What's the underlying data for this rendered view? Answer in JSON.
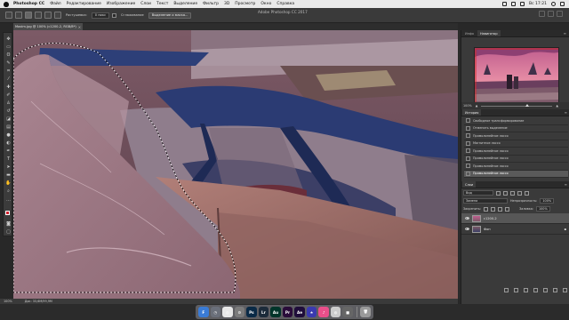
{
  "menubar": {
    "app": "Photoshop CC",
    "items": [
      "Файл",
      "Редактирование",
      "Изображение",
      "Слои",
      "Текст",
      "Выделение",
      "Фильтр",
      "3D",
      "Просмотр",
      "Окно",
      "Справка"
    ],
    "clock": "Вс 17:21"
  },
  "window_title": "Adobe Photoshop CC 2017",
  "options": {
    "feather_label": "Растушевка:",
    "feather_value": "0 пикс",
    "antialias_label": "Сглаживание",
    "select_mask_button": "Выделение и маска..."
  },
  "document": {
    "tab_label": "Maxim.jpg @ 100% (c1200-2, RGB/8*)",
    "close_glyph": "×"
  },
  "status": {
    "zoom": "100%",
    "doc_size": "Док: 33,6M/99,9M"
  },
  "panels": {
    "top_tabs": [
      "Инфо",
      "Навигатор"
    ],
    "navigator_zoom": "100%",
    "history_tab": "История",
    "history_items": [
      "Свободное трансформирование",
      "Отменить выделение",
      "Прямолинейное лассо",
      "Магнитное лассо",
      "Прямолинейное лассо",
      "Прямолинейное лассо",
      "Прямолинейное лассо",
      "Прямолинейное лассо"
    ],
    "history_selected_index": 7,
    "layers_tab": "Слои",
    "filter_kind": "Вид",
    "blend_mode": "Замена",
    "opacity_label": "Непрозрачность:",
    "opacity_value": "100%",
    "lock_label": "Закрепить:",
    "fill_label": "Заливка:",
    "fill_value": "100%",
    "layers": [
      {
        "name": "c1200-2",
        "selected": true
      },
      {
        "name": "Фон",
        "selected": false
      }
    ]
  },
  "dock": {
    "apps": [
      {
        "label": "F",
        "color": "#3a7bd5",
        "name": "finder"
      },
      {
        "label": "◷",
        "color": "#6a6f7a",
        "name": "launchpad"
      },
      {
        "label": "◎",
        "color": "#e8e8e8",
        "name": "chrome"
      },
      {
        "label": "⚙",
        "color": "#7b7b7b",
        "name": "system-preferences"
      },
      {
        "label": "Ps",
        "color": "#0a2a46",
        "name": "photoshop"
      },
      {
        "label": "Lr",
        "color": "#1c2b3a",
        "name": "lightroom"
      },
      {
        "label": "Au",
        "color": "#00352a",
        "name": "audition"
      },
      {
        "label": "Pr",
        "color": "#2a0c3a",
        "name": "premiere"
      },
      {
        "label": "Ae",
        "color": "#1f0d3a",
        "name": "after-effects"
      },
      {
        "label": "★",
        "color": "#3a3ab0",
        "name": "imovie"
      },
      {
        "label": "♪",
        "color": "#e94f8a",
        "name": "itunes"
      },
      {
        "label": "◍",
        "color": "#cccccc",
        "name": "photos"
      },
      {
        "label": "■",
        "color": "#666666",
        "name": "terminal"
      },
      {
        "label": "🗑",
        "color": "#9a9a9a",
        "name": "trash"
      }
    ]
  }
}
